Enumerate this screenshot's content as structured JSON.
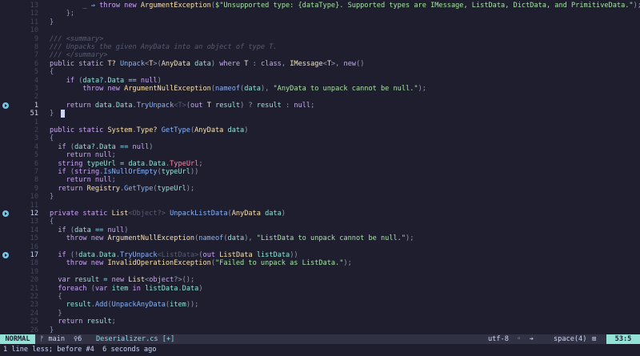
{
  "editor": {
    "lines": [
      {
        "num": "13",
        "sign": false,
        "cur": false,
        "parts": [
          [
            "ws",
            "    "
          ],
          [
            "cm",
            "    "
          ],
          [
            "pa",
            "_ "
          ],
          [
            "op",
            "⇒ "
          ],
          [
            "kw",
            "throw "
          ],
          [
            "kw",
            "new "
          ],
          [
            "ty",
            "ArgumentException"
          ],
          [
            "pa",
            "("
          ],
          [
            "st",
            "$\"Unsupported type: {dataType}. Supported types are IMessage, ListData, DictData, and PrimitiveData.\""
          ],
          [
            "pa",
            ");"
          ]
        ]
      },
      {
        "num": "12",
        "sign": false,
        "cur": false,
        "parts": [
          [
            "ws",
            "    "
          ],
          [
            "pa",
            "};"
          ]
        ]
      },
      {
        "num": "11",
        "sign": false,
        "cur": false,
        "parts": [
          [
            "pa",
            "}"
          ]
        ]
      },
      {
        "num": "10",
        "sign": false,
        "cur": false,
        "parts": [
          [
            "pa",
            ""
          ]
        ]
      },
      {
        "num": "9",
        "sign": false,
        "cur": false,
        "parts": [
          [
            "cm",
            "/// <summary>"
          ]
        ]
      },
      {
        "num": "8",
        "sign": false,
        "cur": false,
        "parts": [
          [
            "cm",
            "/// Unpacks the given AnyData into an object of type T."
          ]
        ]
      },
      {
        "num": "7",
        "sign": false,
        "cur": false,
        "parts": [
          [
            "cm",
            "/// </summary>"
          ]
        ]
      },
      {
        "num": "6",
        "sign": false,
        "cur": false,
        "parts": [
          [
            "kw",
            "public static "
          ],
          [
            "ty",
            "T? "
          ],
          [
            "fn",
            "Unpack"
          ],
          [
            "pa",
            "<"
          ],
          [
            "ty",
            "T"
          ],
          [
            "pa",
            ">("
          ],
          [
            "ty",
            "AnyData "
          ],
          [
            "pr",
            "data"
          ],
          [
            "pa",
            ") "
          ],
          [
            "kw",
            "where "
          ],
          [
            "ty",
            "T "
          ],
          [
            "pa",
            ": "
          ],
          [
            "kw",
            "class"
          ],
          [
            "pa",
            ", "
          ],
          [
            "ty",
            "IMessage"
          ],
          [
            "pa",
            "<"
          ],
          [
            "ty",
            "T"
          ],
          [
            "pa",
            ">, "
          ],
          [
            "kw",
            "new"
          ],
          [
            "pa",
            "()"
          ]
        ]
      },
      {
        "num": "5",
        "sign": false,
        "cur": false,
        "parts": [
          [
            "pa",
            "{"
          ]
        ]
      },
      {
        "num": "4",
        "sign": false,
        "cur": false,
        "parts": [
          [
            "ws",
            "    "
          ],
          [
            "kw",
            "if "
          ],
          [
            "pa",
            "("
          ],
          [
            "pr",
            "data"
          ],
          [
            "op",
            "?."
          ],
          [
            "pr",
            "Data "
          ],
          [
            "op",
            "== "
          ],
          [
            "kw",
            "null"
          ],
          [
            "pa",
            ")"
          ]
        ]
      },
      {
        "num": "3",
        "sign": false,
        "cur": false,
        "parts": [
          [
            "ws",
            "        "
          ],
          [
            "kw",
            "throw new "
          ],
          [
            "ty",
            "ArgumentNullException"
          ],
          [
            "pa",
            "("
          ],
          [
            "fn",
            "nameof"
          ],
          [
            "pa",
            "("
          ],
          [
            "pr",
            "data"
          ],
          [
            "pa",
            "), "
          ],
          [
            "st",
            "\"AnyData to unpack cannot be null.\""
          ],
          [
            "pa",
            ");"
          ]
        ]
      },
      {
        "num": "2",
        "sign": false,
        "cur": false,
        "parts": [
          [
            "pa",
            ""
          ]
        ]
      },
      {
        "num": "1",
        "sign": true,
        "cur": false,
        "parts": [
          [
            "ws",
            "    "
          ],
          [
            "kw",
            "return "
          ],
          [
            "pr",
            "data"
          ],
          [
            "pa",
            "."
          ],
          [
            "pr",
            "Data"
          ],
          [
            "pa",
            "."
          ],
          [
            "fn",
            "TryUnpack"
          ],
          [
            "dim",
            "<T>"
          ],
          [
            "pa",
            "("
          ],
          [
            "kw",
            "out "
          ],
          [
            "ty",
            "T "
          ],
          [
            "pr",
            "result"
          ],
          [
            "pa",
            ") ? "
          ],
          [
            "pr",
            "result "
          ],
          [
            "pa",
            ": "
          ],
          [
            "kw",
            "null"
          ],
          [
            "pa",
            ";"
          ]
        ]
      },
      {
        "num": "51",
        "sign": false,
        "cur": true,
        "parts": [
          [
            "pa",
            "}"
          ]
        ]
      },
      {
        "num": "1",
        "sign": false,
        "cur": false,
        "parts": [
          [
            "pa",
            ""
          ]
        ]
      },
      {
        "num": "2",
        "sign": false,
        "cur": false,
        "parts": [
          [
            "kw",
            "public static "
          ],
          [
            "ty",
            "System"
          ],
          [
            "pa",
            "."
          ],
          [
            "ty",
            "Type? "
          ],
          [
            "fn",
            "GetType"
          ],
          [
            "pa",
            "("
          ],
          [
            "ty",
            "AnyData "
          ],
          [
            "pr",
            "data"
          ],
          [
            "pa",
            ")"
          ]
        ]
      },
      {
        "num": "3",
        "sign": false,
        "cur": false,
        "parts": [
          [
            "pa",
            "{"
          ]
        ]
      },
      {
        "num": "4",
        "sign": false,
        "cur": false,
        "parts": [
          [
            "ws",
            "  "
          ],
          [
            "kw",
            "if "
          ],
          [
            "pa",
            "("
          ],
          [
            "pr",
            "data"
          ],
          [
            "op",
            "?."
          ],
          [
            "pr",
            "Data "
          ],
          [
            "op",
            "== "
          ],
          [
            "kw",
            "null"
          ],
          [
            "pa",
            ")"
          ]
        ]
      },
      {
        "num": "5",
        "sign": false,
        "cur": false,
        "parts": [
          [
            "ws",
            "    "
          ],
          [
            "kw",
            "return "
          ],
          [
            "kw",
            "null"
          ],
          [
            "pa",
            ";"
          ]
        ]
      },
      {
        "num": "6",
        "sign": false,
        "cur": false,
        "parts": [
          [
            "ws",
            "  "
          ],
          [
            "kw",
            "string "
          ],
          [
            "pr",
            "typeUrl "
          ],
          [
            "op",
            "= "
          ],
          [
            "pr",
            "data"
          ],
          [
            "pa",
            "."
          ],
          [
            "pr",
            "Data"
          ],
          [
            "pa",
            "."
          ],
          [
            "vr",
            "TypeUrl"
          ],
          [
            "pa",
            ";"
          ]
        ]
      },
      {
        "num": "7",
        "sign": false,
        "cur": false,
        "parts": [
          [
            "ws",
            "  "
          ],
          [
            "kw",
            "if "
          ],
          [
            "pa",
            "("
          ],
          [
            "kw",
            "string"
          ],
          [
            "pa",
            "."
          ],
          [
            "fn",
            "IsNullOrEmpty"
          ],
          [
            "pa",
            "("
          ],
          [
            "pr",
            "typeUrl"
          ],
          [
            "pa",
            "))"
          ]
        ]
      },
      {
        "num": "8",
        "sign": false,
        "cur": false,
        "parts": [
          [
            "ws",
            "    "
          ],
          [
            "kw",
            "return "
          ],
          [
            "kw",
            "null"
          ],
          [
            "pa",
            ";"
          ]
        ]
      },
      {
        "num": "9",
        "sign": false,
        "cur": false,
        "parts": [
          [
            "ws",
            "  "
          ],
          [
            "kw",
            "return "
          ],
          [
            "ty",
            "Registry"
          ],
          [
            "pa",
            "."
          ],
          [
            "fn",
            "GetType"
          ],
          [
            "pa",
            "("
          ],
          [
            "pr",
            "typeUrl"
          ],
          [
            "pa",
            ");"
          ]
        ]
      },
      {
        "num": "10",
        "sign": false,
        "cur": false,
        "parts": [
          [
            "pa",
            "}"
          ]
        ]
      },
      {
        "num": "11",
        "sign": false,
        "cur": false,
        "parts": [
          [
            "pa",
            ""
          ]
        ]
      },
      {
        "num": "12",
        "sign": true,
        "cur": false,
        "parts": [
          [
            "kw",
            "private static "
          ],
          [
            "ty",
            "List"
          ],
          [
            "dim",
            "<Object?> "
          ],
          [
            "fn",
            "UnpackListData"
          ],
          [
            "pa",
            "("
          ],
          [
            "ty",
            "AnyData "
          ],
          [
            "pr",
            "data"
          ],
          [
            "pa",
            ")"
          ]
        ]
      },
      {
        "num": "13",
        "sign": false,
        "cur": false,
        "parts": [
          [
            "pa",
            "{"
          ]
        ]
      },
      {
        "num": "14",
        "sign": false,
        "cur": false,
        "parts": [
          [
            "ws",
            "  "
          ],
          [
            "kw",
            "if "
          ],
          [
            "pa",
            "("
          ],
          [
            "pr",
            "data "
          ],
          [
            "op",
            "== "
          ],
          [
            "kw",
            "null"
          ],
          [
            "pa",
            ")"
          ]
        ]
      },
      {
        "num": "15",
        "sign": false,
        "cur": false,
        "parts": [
          [
            "ws",
            "    "
          ],
          [
            "kw",
            "throw new "
          ],
          [
            "ty",
            "ArgumentNullException"
          ],
          [
            "pa",
            "("
          ],
          [
            "fn",
            "nameof"
          ],
          [
            "pa",
            "("
          ],
          [
            "pr",
            "data"
          ],
          [
            "pa",
            "), "
          ],
          [
            "st",
            "\"ListData to unpack cannot be null.\""
          ],
          [
            "pa",
            ");"
          ]
        ]
      },
      {
        "num": "16",
        "sign": false,
        "cur": false,
        "parts": [
          [
            "pa",
            ""
          ]
        ]
      },
      {
        "num": "17",
        "sign": true,
        "cur": false,
        "parts": [
          [
            "ws",
            "  "
          ],
          [
            "kw",
            "if "
          ],
          [
            "pa",
            "(!"
          ],
          [
            "pr",
            "data"
          ],
          [
            "pa",
            "."
          ],
          [
            "pr",
            "Data"
          ],
          [
            "pa",
            "."
          ],
          [
            "fn",
            "TryUnpack"
          ],
          [
            "dim",
            "<ListData>"
          ],
          [
            "pa",
            "("
          ],
          [
            "kw",
            "out "
          ],
          [
            "ty",
            "ListData "
          ],
          [
            "pr",
            "listData"
          ],
          [
            "pa",
            "))"
          ]
        ]
      },
      {
        "num": "18",
        "sign": false,
        "cur": false,
        "parts": [
          [
            "ws",
            "    "
          ],
          [
            "kw",
            "throw new "
          ],
          [
            "ty",
            "InvalidOperationException"
          ],
          [
            "pa",
            "("
          ],
          [
            "st",
            "\"Failed to unpack as ListData.\""
          ],
          [
            "pa",
            ");"
          ]
        ]
      },
      {
        "num": "19",
        "sign": false,
        "cur": false,
        "parts": [
          [
            "pa",
            ""
          ]
        ]
      },
      {
        "num": "20",
        "sign": false,
        "cur": false,
        "parts": [
          [
            "ws",
            "  "
          ],
          [
            "kw",
            "var "
          ],
          [
            "pr",
            "result "
          ],
          [
            "op",
            "= "
          ],
          [
            "kw",
            "new "
          ],
          [
            "ty",
            "List"
          ],
          [
            "pa",
            "<"
          ],
          [
            "kw",
            "object"
          ],
          [
            "pa",
            "?>();"
          ]
        ]
      },
      {
        "num": "21",
        "sign": false,
        "cur": false,
        "parts": [
          [
            "ws",
            "  "
          ],
          [
            "kw",
            "foreach "
          ],
          [
            "pa",
            "("
          ],
          [
            "kw",
            "var "
          ],
          [
            "pr",
            "item "
          ],
          [
            "kw",
            "in "
          ],
          [
            "pr",
            "listData"
          ],
          [
            "pa",
            "."
          ],
          [
            "pr",
            "Data"
          ],
          [
            "pa",
            ")"
          ]
        ]
      },
      {
        "num": "22",
        "sign": false,
        "cur": false,
        "parts": [
          [
            "ws",
            "  "
          ],
          [
            "pa",
            "{"
          ]
        ]
      },
      {
        "num": "23",
        "sign": false,
        "cur": false,
        "parts": [
          [
            "ws",
            "    "
          ],
          [
            "pr",
            "result"
          ],
          [
            "pa",
            "."
          ],
          [
            "fn",
            "Add"
          ],
          [
            "pa",
            "("
          ],
          [
            "fn",
            "UnpackAnyData"
          ],
          [
            "pa",
            "("
          ],
          [
            "pr",
            "item"
          ],
          [
            "pa",
            "));"
          ]
        ]
      },
      {
        "num": "24",
        "sign": false,
        "cur": false,
        "parts": [
          [
            "ws",
            "  "
          ],
          [
            "pa",
            "}"
          ]
        ]
      },
      {
        "num": "25",
        "sign": false,
        "cur": false,
        "parts": [
          [
            "ws",
            "  "
          ],
          [
            "kw",
            "return "
          ],
          [
            "pr",
            "result"
          ],
          [
            "pa",
            ";"
          ]
        ]
      },
      {
        "num": "26",
        "sign": false,
        "cur": false,
        "parts": [
          [
            "pa",
            "}"
          ]
        ]
      }
    ]
  },
  "statusline": {
    "mode": "NORMAL",
    "branch": "ᚠ main",
    "diagnostics": "♀6",
    "filename": "Deserializer.cs [+]",
    "encoding": "utf-8  ◦  ➔",
    "indent": "space(4)",
    "mode_icon": "⊞",
    "position": "53:5"
  },
  "message": "1 line less; before #4  6 seconds ago"
}
